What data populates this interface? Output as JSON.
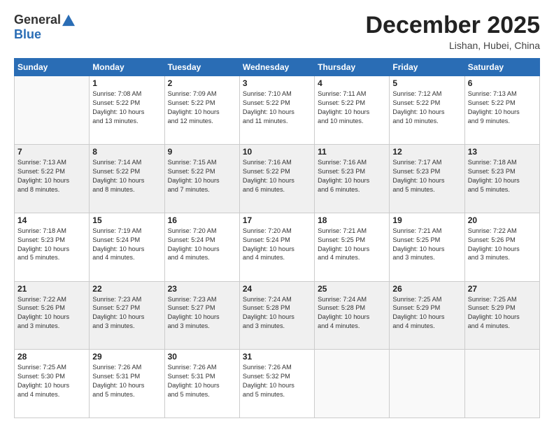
{
  "header": {
    "logo_general": "General",
    "logo_blue": "Blue",
    "month_title": "December 2025",
    "location": "Lishan, Hubei, China"
  },
  "weekdays": [
    "Sunday",
    "Monday",
    "Tuesday",
    "Wednesday",
    "Thursday",
    "Friday",
    "Saturday"
  ],
  "weeks": [
    [
      {
        "day": "",
        "info": ""
      },
      {
        "day": "1",
        "info": "Sunrise: 7:08 AM\nSunset: 5:22 PM\nDaylight: 10 hours\nand 13 minutes."
      },
      {
        "day": "2",
        "info": "Sunrise: 7:09 AM\nSunset: 5:22 PM\nDaylight: 10 hours\nand 12 minutes."
      },
      {
        "day": "3",
        "info": "Sunrise: 7:10 AM\nSunset: 5:22 PM\nDaylight: 10 hours\nand 11 minutes."
      },
      {
        "day": "4",
        "info": "Sunrise: 7:11 AM\nSunset: 5:22 PM\nDaylight: 10 hours\nand 10 minutes."
      },
      {
        "day": "5",
        "info": "Sunrise: 7:12 AM\nSunset: 5:22 PM\nDaylight: 10 hours\nand 10 minutes."
      },
      {
        "day": "6",
        "info": "Sunrise: 7:13 AM\nSunset: 5:22 PM\nDaylight: 10 hours\nand 9 minutes."
      }
    ],
    [
      {
        "day": "7",
        "info": "Sunrise: 7:13 AM\nSunset: 5:22 PM\nDaylight: 10 hours\nand 8 minutes."
      },
      {
        "day": "8",
        "info": "Sunrise: 7:14 AM\nSunset: 5:22 PM\nDaylight: 10 hours\nand 8 minutes."
      },
      {
        "day": "9",
        "info": "Sunrise: 7:15 AM\nSunset: 5:22 PM\nDaylight: 10 hours\nand 7 minutes."
      },
      {
        "day": "10",
        "info": "Sunrise: 7:16 AM\nSunset: 5:22 PM\nDaylight: 10 hours\nand 6 minutes."
      },
      {
        "day": "11",
        "info": "Sunrise: 7:16 AM\nSunset: 5:23 PM\nDaylight: 10 hours\nand 6 minutes."
      },
      {
        "day": "12",
        "info": "Sunrise: 7:17 AM\nSunset: 5:23 PM\nDaylight: 10 hours\nand 5 minutes."
      },
      {
        "day": "13",
        "info": "Sunrise: 7:18 AM\nSunset: 5:23 PM\nDaylight: 10 hours\nand 5 minutes."
      }
    ],
    [
      {
        "day": "14",
        "info": "Sunrise: 7:18 AM\nSunset: 5:23 PM\nDaylight: 10 hours\nand 5 minutes."
      },
      {
        "day": "15",
        "info": "Sunrise: 7:19 AM\nSunset: 5:24 PM\nDaylight: 10 hours\nand 4 minutes."
      },
      {
        "day": "16",
        "info": "Sunrise: 7:20 AM\nSunset: 5:24 PM\nDaylight: 10 hours\nand 4 minutes."
      },
      {
        "day": "17",
        "info": "Sunrise: 7:20 AM\nSunset: 5:24 PM\nDaylight: 10 hours\nand 4 minutes."
      },
      {
        "day": "18",
        "info": "Sunrise: 7:21 AM\nSunset: 5:25 PM\nDaylight: 10 hours\nand 4 minutes."
      },
      {
        "day": "19",
        "info": "Sunrise: 7:21 AM\nSunset: 5:25 PM\nDaylight: 10 hours\nand 3 minutes."
      },
      {
        "day": "20",
        "info": "Sunrise: 7:22 AM\nSunset: 5:26 PM\nDaylight: 10 hours\nand 3 minutes."
      }
    ],
    [
      {
        "day": "21",
        "info": "Sunrise: 7:22 AM\nSunset: 5:26 PM\nDaylight: 10 hours\nand 3 minutes."
      },
      {
        "day": "22",
        "info": "Sunrise: 7:23 AM\nSunset: 5:27 PM\nDaylight: 10 hours\nand 3 minutes."
      },
      {
        "day": "23",
        "info": "Sunrise: 7:23 AM\nSunset: 5:27 PM\nDaylight: 10 hours\nand 3 minutes."
      },
      {
        "day": "24",
        "info": "Sunrise: 7:24 AM\nSunset: 5:28 PM\nDaylight: 10 hours\nand 3 minutes."
      },
      {
        "day": "25",
        "info": "Sunrise: 7:24 AM\nSunset: 5:28 PM\nDaylight: 10 hours\nand 4 minutes."
      },
      {
        "day": "26",
        "info": "Sunrise: 7:25 AM\nSunset: 5:29 PM\nDaylight: 10 hours\nand 4 minutes."
      },
      {
        "day": "27",
        "info": "Sunrise: 7:25 AM\nSunset: 5:29 PM\nDaylight: 10 hours\nand 4 minutes."
      }
    ],
    [
      {
        "day": "28",
        "info": "Sunrise: 7:25 AM\nSunset: 5:30 PM\nDaylight: 10 hours\nand 4 minutes."
      },
      {
        "day": "29",
        "info": "Sunrise: 7:26 AM\nSunset: 5:31 PM\nDaylight: 10 hours\nand 5 minutes."
      },
      {
        "day": "30",
        "info": "Sunrise: 7:26 AM\nSunset: 5:31 PM\nDaylight: 10 hours\nand 5 minutes."
      },
      {
        "day": "31",
        "info": "Sunrise: 7:26 AM\nSunset: 5:32 PM\nDaylight: 10 hours\nand 5 minutes."
      },
      {
        "day": "",
        "info": ""
      },
      {
        "day": "",
        "info": ""
      },
      {
        "day": "",
        "info": ""
      }
    ]
  ]
}
